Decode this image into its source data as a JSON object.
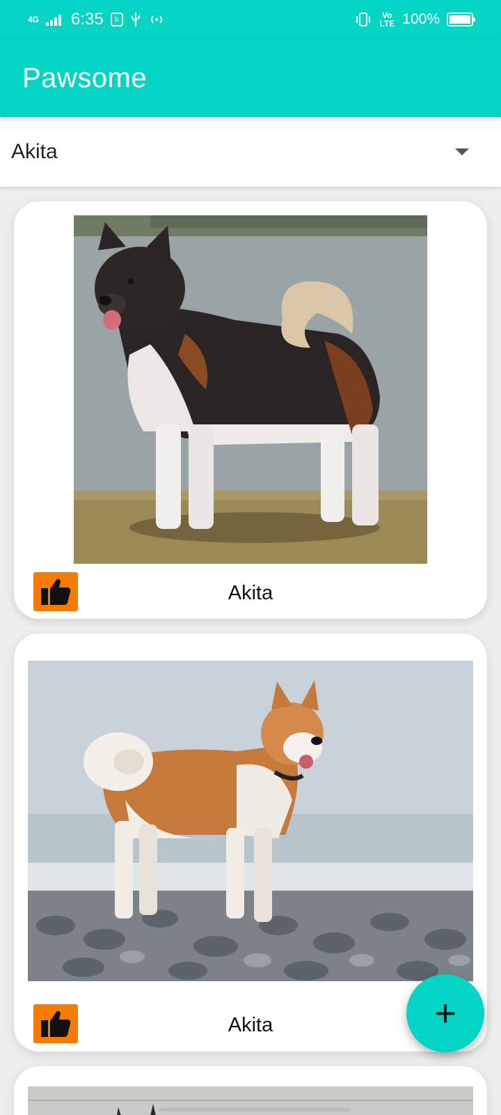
{
  "status_bar": {
    "network": "4G",
    "time": "6:35",
    "battery": "100%",
    "volte": "Vo LTE"
  },
  "app": {
    "title": "Pawsome"
  },
  "breed_selector": {
    "selected": "Akita"
  },
  "cards": [
    {
      "label": "Akita",
      "like_icon": "thumbs-up-icon"
    },
    {
      "label": "Akita",
      "like_icon": "thumbs-up-icon"
    },
    {
      "label": ""
    }
  ],
  "fab": {
    "icon": "plus-icon",
    "label": "+"
  },
  "colors": {
    "accent": "#03D4C4",
    "like_button": "#F57C00"
  }
}
